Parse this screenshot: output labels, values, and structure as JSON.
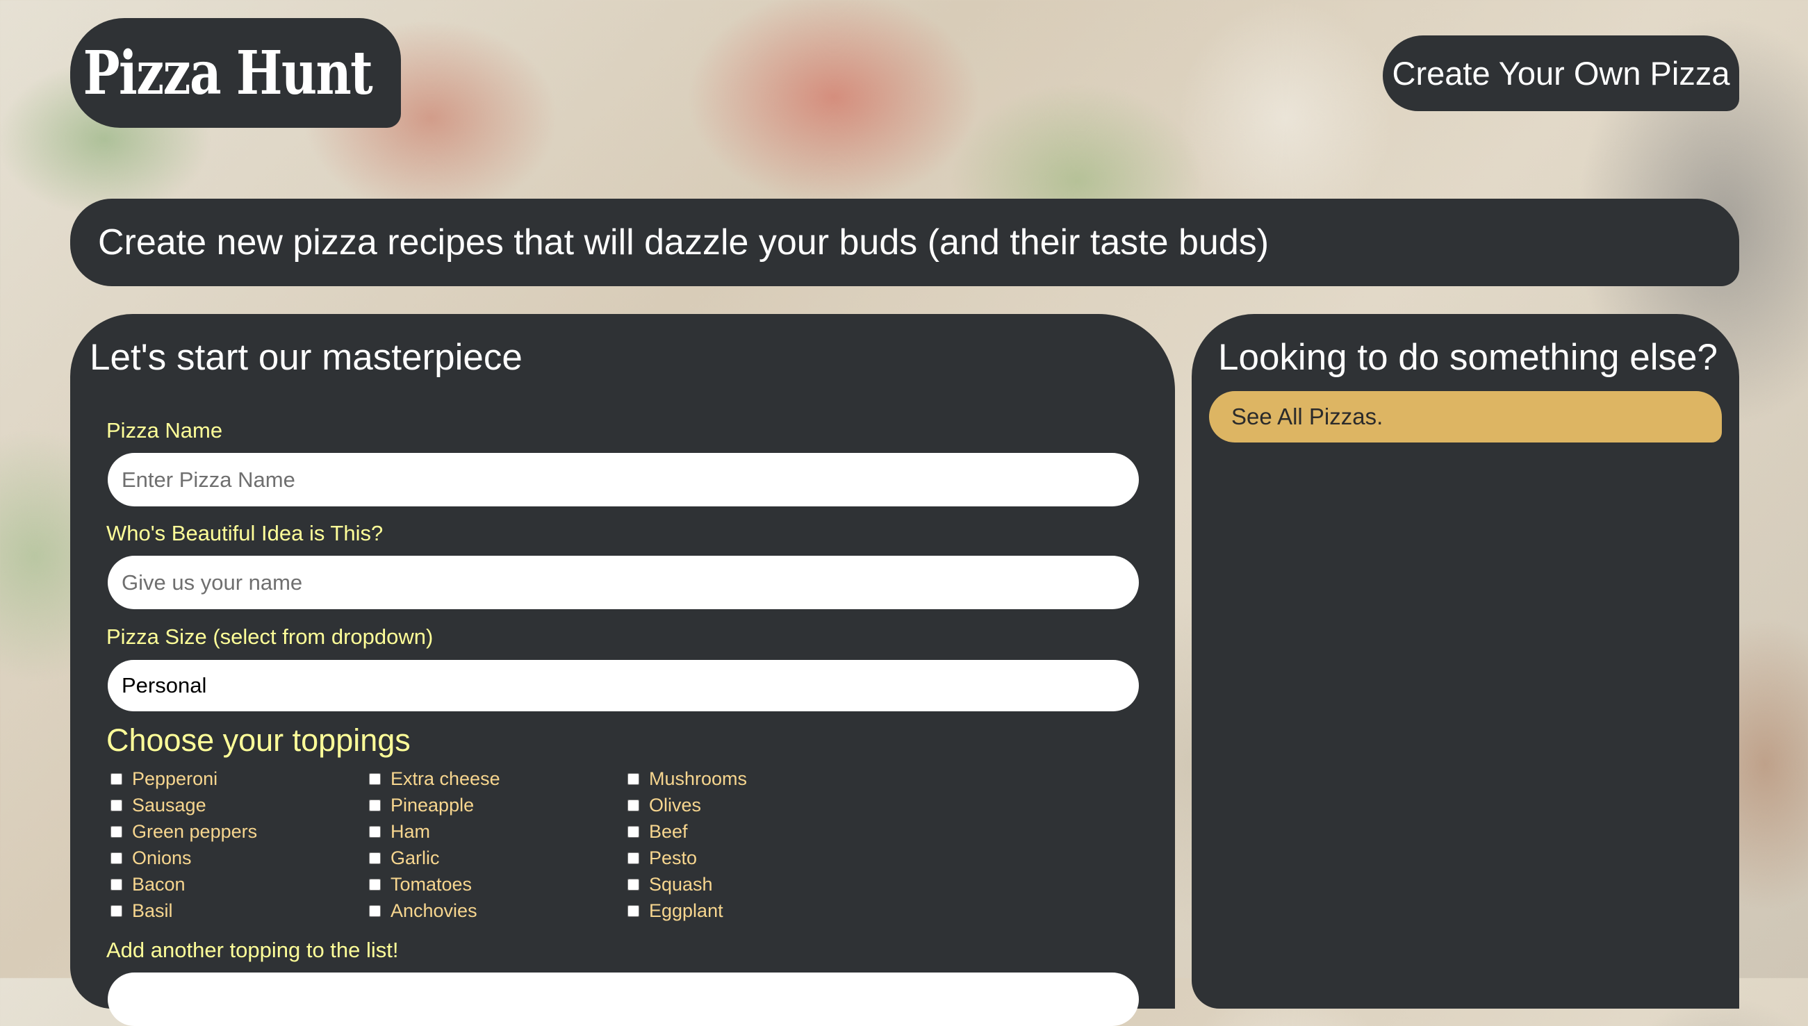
{
  "header": {
    "logo": "Pizza Hunt",
    "create_button": "Create Your Own Pizza"
  },
  "banner": {
    "text": "Create new pizza recipes that will dazzle your buds (and their taste buds)"
  },
  "form": {
    "title": "Let's start our masterpiece",
    "pizza_name_label": "Pizza Name",
    "pizza_name_placeholder": "Enter Pizza Name",
    "creator_label": "Who's Beautiful Idea is This?",
    "creator_placeholder": "Give us your name",
    "size_label": "Pizza Size (select from dropdown)",
    "size_value": "Personal",
    "toppings_title": "Choose your toppings",
    "toppings": [
      "Pepperoni",
      "Sausage",
      "Green peppers",
      "Onions",
      "Bacon",
      "Basil",
      "Extra cheese",
      "Pineapple",
      "Ham",
      "Garlic",
      "Tomatoes",
      "Anchovies",
      "Mushrooms",
      "Olives",
      "Beef",
      "Pesto",
      "Squash",
      "Eggplant"
    ],
    "add_topping_label": "Add another topping to the list!"
  },
  "sidebar": {
    "title": "Looking to do something else?",
    "see_all": "See All Pizzas."
  }
}
